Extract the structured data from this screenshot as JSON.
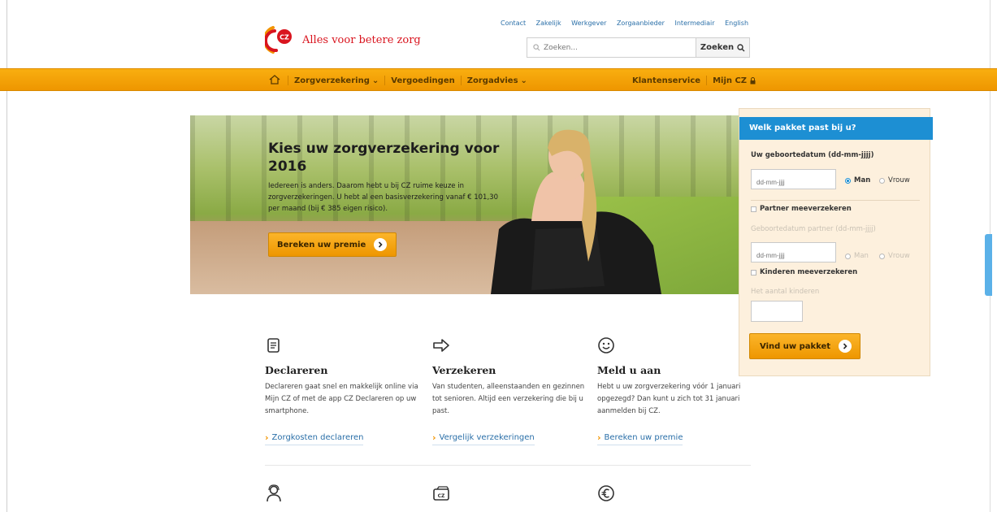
{
  "header": {
    "logo_text": "Alles voor betere zorg",
    "logo_badge": "CZ",
    "top_links": [
      "Contact",
      "Zakelijk",
      "Werkgever",
      "Zorgaanbieder",
      "Intermediair",
      "English"
    ],
    "search": {
      "placeholder": "Zoeken...",
      "button_label": "Zoeken"
    }
  },
  "nav": {
    "items": [
      {
        "label": "Zorgverzekering",
        "caret": "⌄"
      },
      {
        "label": "Vergoedingen"
      },
      {
        "label": "Zorgadvies",
        "caret": "⌄"
      }
    ],
    "right": [
      {
        "label": "Klantenservice"
      },
      {
        "label": "Mijn CZ",
        "icon": "lock-icon"
      }
    ]
  },
  "hero": {
    "title": "Kies uw zorgverzekering voor 2016",
    "body": "Iedereen is anders. Daarom hebt u bij CZ ruime keuze in zorgverzekeringen. U hebt al een basisverzekering vanaf € 101,30 per maand (bij € 385 eigen risico).",
    "button_label": "Bereken uw premie"
  },
  "widget": {
    "title": "Welk pakket past bij u?",
    "birth_label": "Uw geboortedatum (dd-mm-jjjj)",
    "birth_placeholder": "dd-mm-jjjj",
    "gender_options": [
      "Man",
      "Vrouw"
    ],
    "gender_selected": "Man",
    "partner_check": "Partner meeverzekeren",
    "partner_birth_label": "Geboortedatum partner (dd-mm-jjjj)",
    "partner_placeholder": "dd-mm-jjjj",
    "children_check": "Kinderen meeverzekeren",
    "children_count_label": "Het aantal kinderen",
    "button_label": "Vind uw pakket"
  },
  "features": [
    {
      "icon": "declaration-form-icon",
      "title": "Declareren",
      "text": "Declareren gaat snel en makkelijk online via Mijn CZ of met de app CZ Declareren op uw smartphone.",
      "link": "Zorgkosten declareren"
    },
    {
      "icon": "arrow-right-icon",
      "title": "Verzekeren",
      "text": "Van studenten, alleenstaanden en gezinnen tot senioren. Altijd een verzekering die bij u past.",
      "link": "Vergelijk verzekeringen"
    },
    {
      "icon": "smiley-icon",
      "title": "Meld u aan",
      "text": "Hebt u uw zorgverzekering vóór 1 januari opgezegd? Dan kunt u zich tot 31 januari aanmelden bij CZ.",
      "link": "Bereken uw premie"
    }
  ],
  "bottom_icons": [
    "person-support-icon",
    "cz-card-icon",
    "euro-icon"
  ],
  "colors": {
    "accent_orange": "#f29400",
    "widget_blue": "#1d8fd3",
    "brand_red": "#d9141e"
  }
}
